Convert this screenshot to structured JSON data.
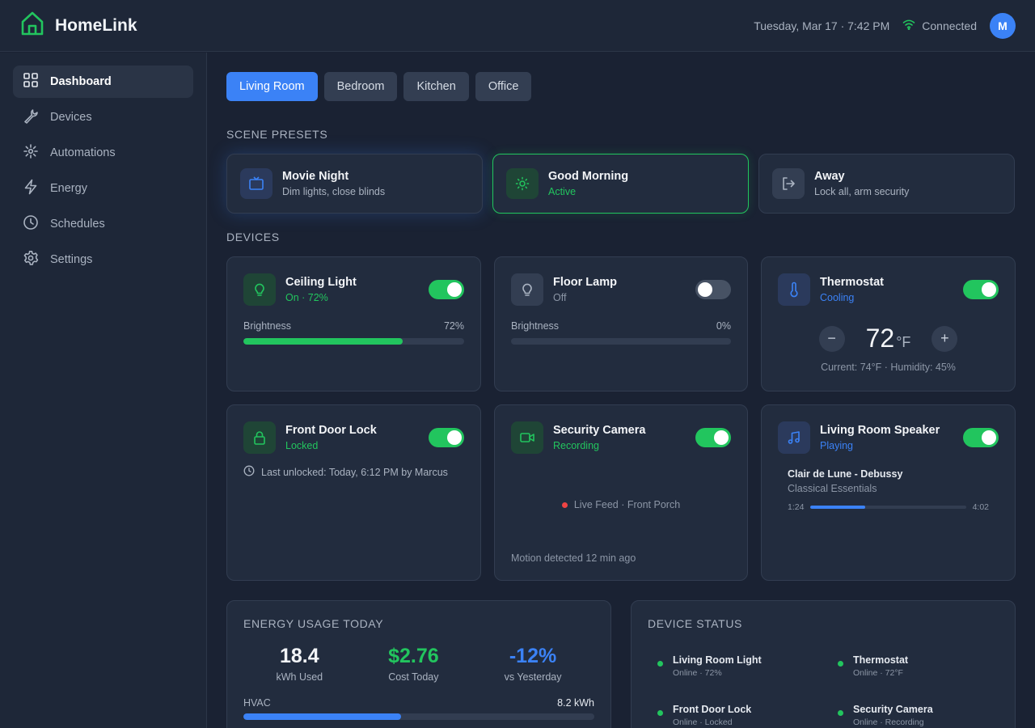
{
  "app": {
    "name": "HomeLink"
  },
  "header": {
    "datetime": "Tuesday, Mar 17 · 7:42 PM",
    "connection": "Connected",
    "avatar_initial": "M"
  },
  "sidebar": {
    "items": [
      {
        "label": "Dashboard",
        "icon": "grid-icon",
        "active": true
      },
      {
        "label": "Devices",
        "icon": "wrench-icon"
      },
      {
        "label": "Automations",
        "icon": "sparkle-icon"
      },
      {
        "label": "Energy",
        "icon": "bolt-icon"
      },
      {
        "label": "Schedules",
        "icon": "clock-icon"
      },
      {
        "label": "Settings",
        "icon": "gear-icon"
      }
    ]
  },
  "rooms": {
    "tabs": [
      "Living Room",
      "Bedroom",
      "Kitchen",
      "Office"
    ],
    "active": "Living Room"
  },
  "scenes": {
    "title": "SCENE PRESETS",
    "items": [
      {
        "name": "Movie Night",
        "sub": "Dim lights, close blinds",
        "icon": "tv-icon"
      },
      {
        "name": "Good Morning",
        "sub": "Active",
        "icon": "sun-icon",
        "active": true
      },
      {
        "name": "Away",
        "sub": "Lock all, arm security",
        "icon": "logout-icon"
      }
    ]
  },
  "devices": {
    "title": "DEVICES",
    "ceiling_light": {
      "name": "Ceiling Light",
      "status": "On · 72%",
      "brightness_label": "Brightness",
      "brightness_text": "72%",
      "brightness": 0.72,
      "on": true
    },
    "floor_lamp": {
      "name": "Floor Lamp",
      "status": "Off",
      "brightness_label": "Brightness",
      "brightness_text": "0%",
      "brightness": 0,
      "on": false
    },
    "thermostat": {
      "name": "Thermostat",
      "status": "Cooling",
      "setpoint": "72",
      "unit": "°F",
      "minus": "−",
      "plus": "+",
      "detail": "Current: 74°F · Humidity: 45%",
      "on": true
    },
    "front_door": {
      "name": "Front Door Lock",
      "status": "Locked",
      "last_unlocked": "Last unlocked: Today, 6:12 PM by Marcus",
      "on": true
    },
    "camera": {
      "name": "Security Camera",
      "status": "Recording",
      "live": "Live Feed · Front Porch",
      "motion": "Motion detected 12 min ago",
      "on": true
    },
    "speaker": {
      "name": "Living Room Speaker",
      "status": "Playing",
      "song": "Clair de Lune - Debussy",
      "album": "Classical Essentials",
      "elapsed": "1:24",
      "duration": "4:02",
      "progress": 0.35,
      "on": true
    }
  },
  "energy": {
    "title": "ENERGY USAGE TODAY",
    "stats": [
      {
        "value": "18.4",
        "label": "kWh Used"
      },
      {
        "value": "$2.76",
        "label": "Cost Today"
      },
      {
        "value": "-12%",
        "label": "vs Yesterday"
      }
    ],
    "hvac_label": "HVAC",
    "hvac_value": "8.2 kWh",
    "hvac_fraction": 0.45
  },
  "status_panel": {
    "title": "DEVICE STATUS",
    "items": [
      {
        "name": "Living Room Light",
        "sub": "Online · 72%"
      },
      {
        "name": "Thermostat",
        "sub": "Online · 72°F"
      },
      {
        "name": "Front Door Lock",
        "sub": "Online · Locked"
      },
      {
        "name": "Security Camera",
        "sub": "Online · Recording"
      }
    ]
  },
  "colors": {
    "accent_blue": "#3b82f6",
    "accent_green": "#22c55e",
    "background": "#1a2233",
    "card": "#222c3e",
    "alert_red": "#ef4444"
  }
}
